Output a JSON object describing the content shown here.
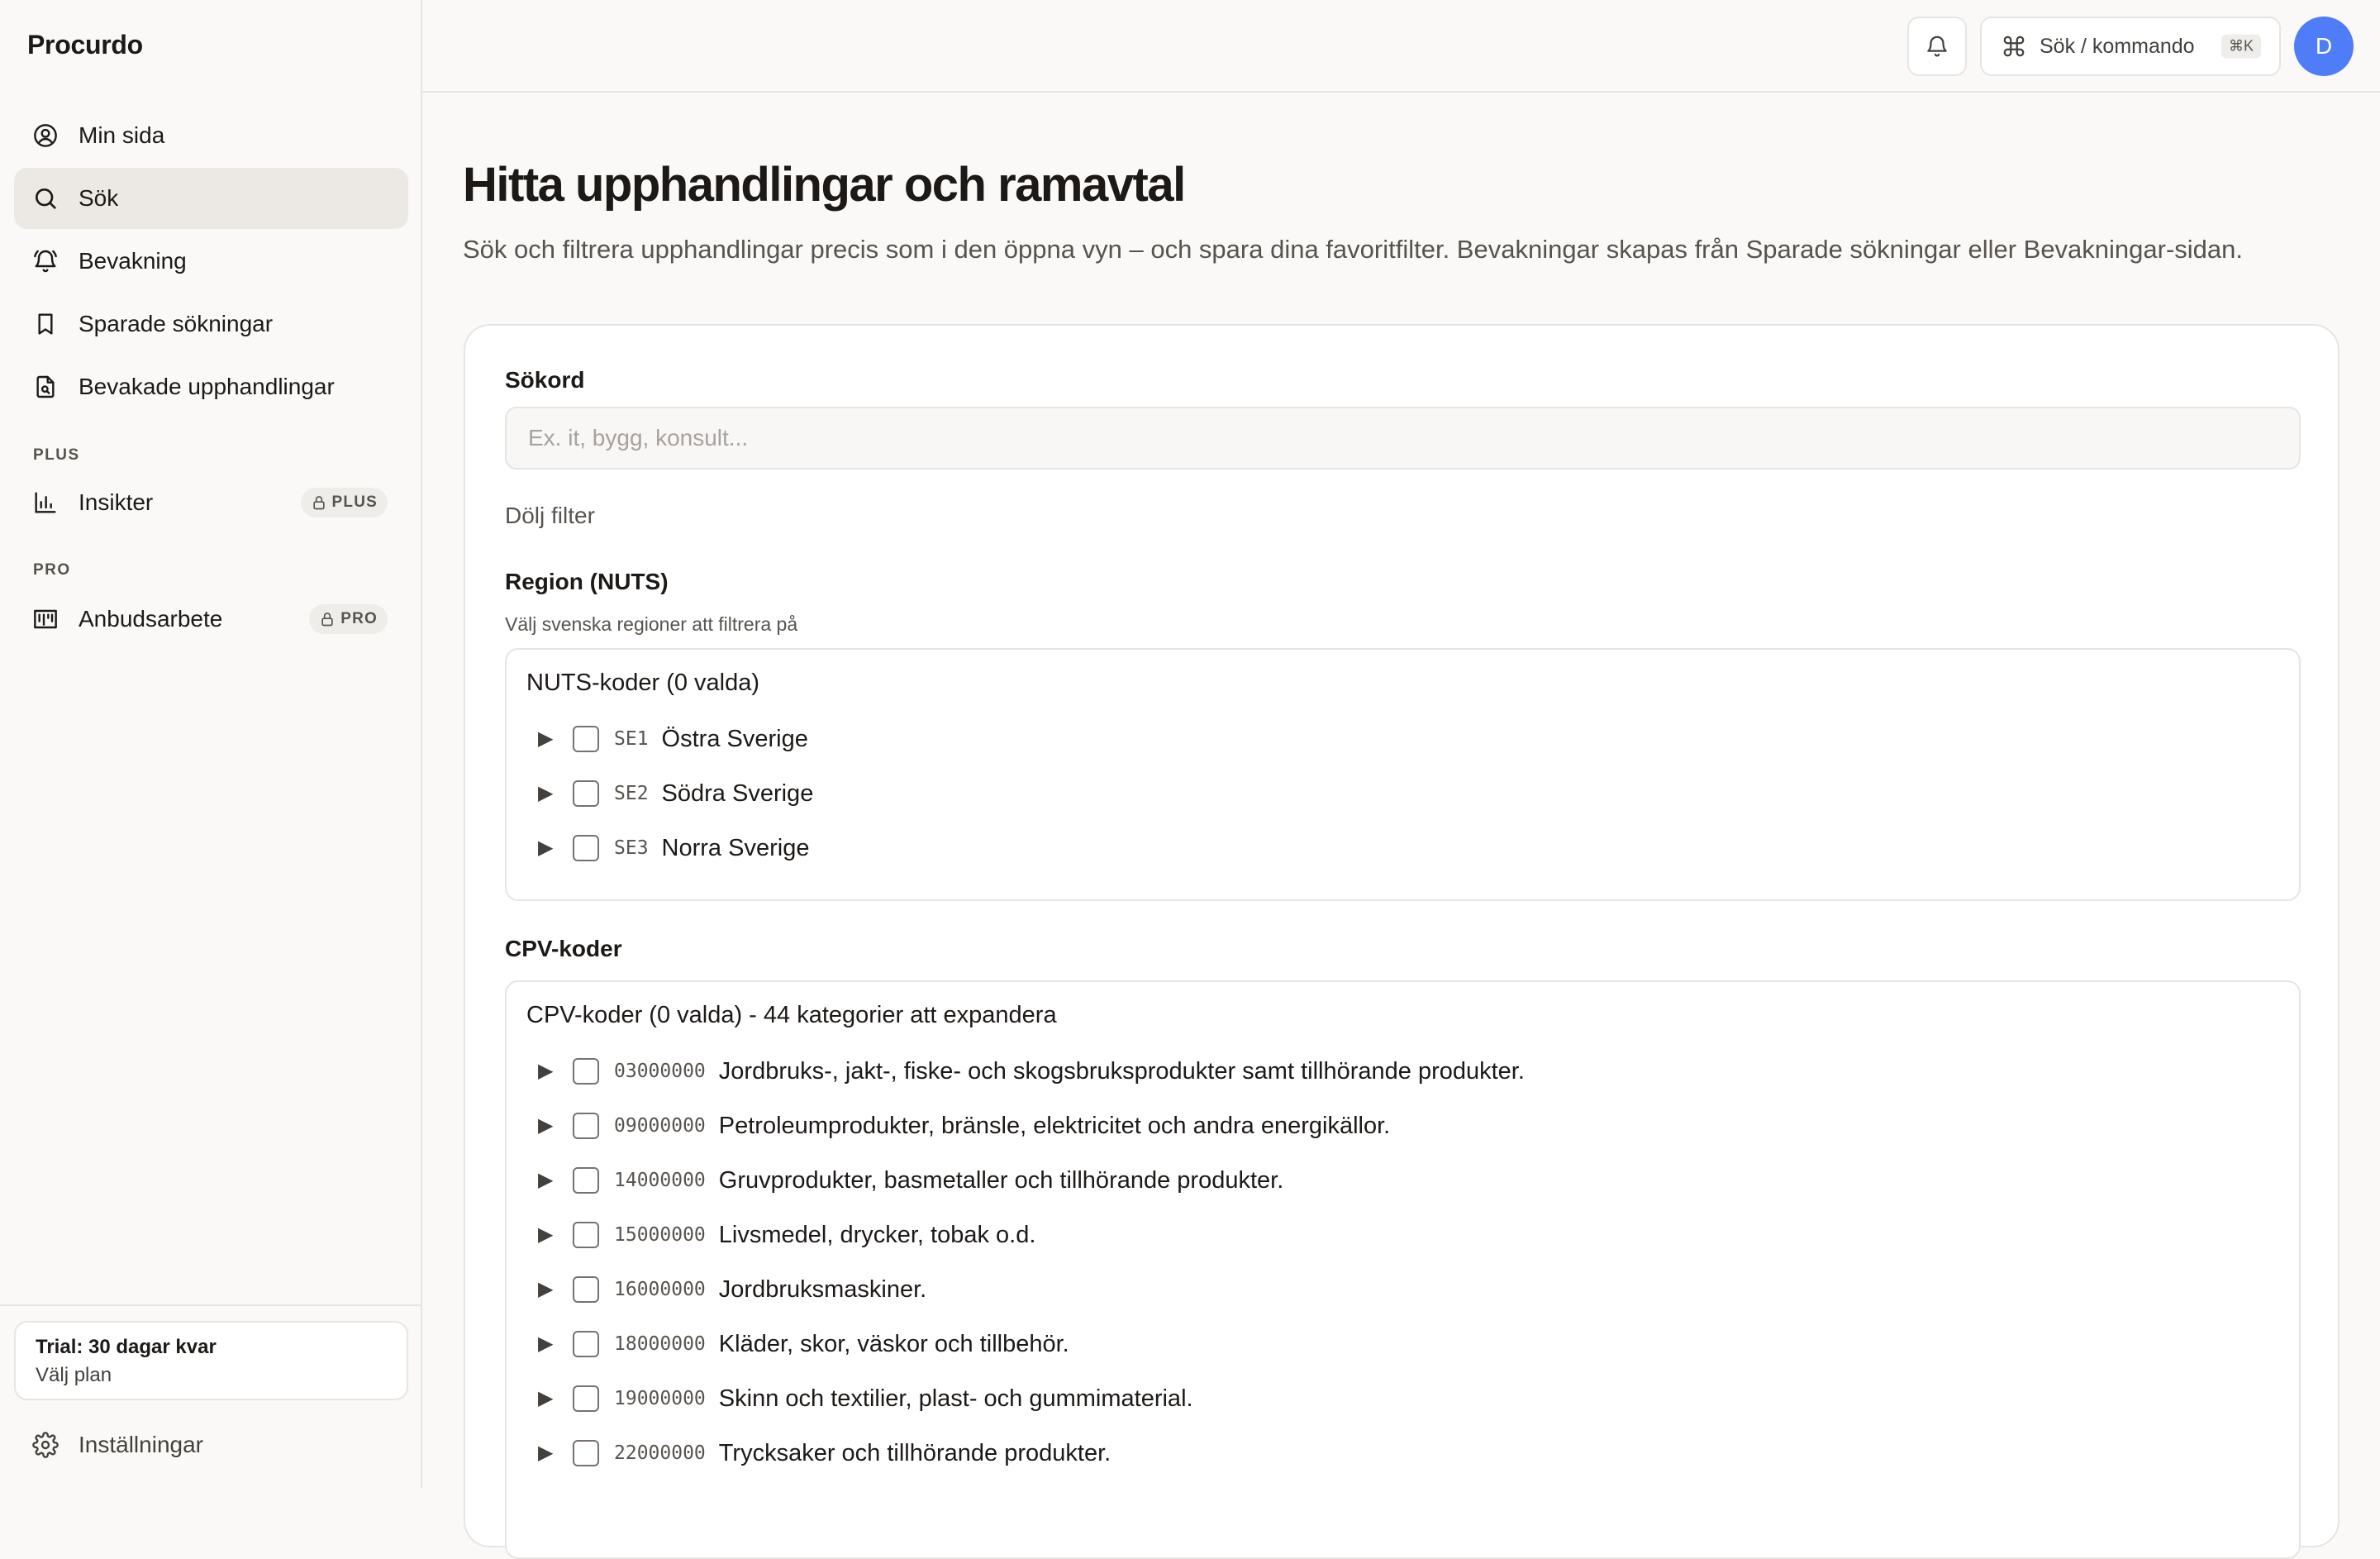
{
  "app": {
    "name": "Procurdo"
  },
  "sidebar": {
    "items": [
      {
        "label": "Min sida"
      },
      {
        "label": "Sök"
      },
      {
        "label": "Bevakning"
      },
      {
        "label": "Sparade sökningar"
      },
      {
        "label": "Bevakade upphandlingar"
      }
    ],
    "plus_section": "PLUS",
    "plus_item": {
      "label": "Insikter",
      "badge": "PLUS"
    },
    "pro_section": "PRO",
    "pro_item": {
      "label": "Anbudsarbete",
      "badge": "PRO"
    },
    "trial": {
      "status": "Trial: 30 dagar kvar",
      "action": "Välj plan"
    },
    "settings_label": "Inställningar"
  },
  "topbar": {
    "command_label": "Sök / kommando",
    "command_shortcut": "⌘K",
    "avatar_initial": "D"
  },
  "main": {
    "title": "Hitta upphandlingar och ramavtal",
    "subtitle": "Sök och filtrera upphandlingar precis som i den öppna vyn – och spara dina favoritfilter. Bevakningar skapas från Sparade sökningar eller Bevakningar-sidan.",
    "search": {
      "label": "Sökord",
      "placeholder": "Ex. it, bygg, konsult...",
      "value": ""
    },
    "toggle_filters": "Dölj filter",
    "region": {
      "label": "Region (NUTS)",
      "hint": "Välj svenska regioner att filtrera på",
      "tree_title": "NUTS-koder (0 valda)",
      "items": [
        {
          "code": "SE1",
          "name": "Östra Sverige"
        },
        {
          "code": "SE2",
          "name": "Södra Sverige"
        },
        {
          "code": "SE3",
          "name": "Norra Sverige"
        }
      ]
    },
    "cpv": {
      "label": "CPV-koder",
      "tree_title": "CPV-koder (0 valda) - 44 kategorier att expandera",
      "items": [
        {
          "code": "03000000",
          "name": "Jordbruks-, jakt-, fiske- och skogsbruksprodukter samt tillhörande produkter."
        },
        {
          "code": "09000000",
          "name": "Petroleumprodukter, bränsle, elektricitet och andra energikällor."
        },
        {
          "code": "14000000",
          "name": "Gruvprodukter, basmetaller och tillhörande produkter."
        },
        {
          "code": "15000000",
          "name": "Livsmedel, drycker, tobak o.d."
        },
        {
          "code": "16000000",
          "name": "Jordbruksmaskiner."
        },
        {
          "code": "18000000",
          "name": "Kläder, skor, väskor och tillbehör."
        },
        {
          "code": "19000000",
          "name": "Skinn och textilier, plast- och gummimaterial."
        },
        {
          "code": "22000000",
          "name": "Trycksaker och tillhörande produkter."
        }
      ]
    }
  }
}
